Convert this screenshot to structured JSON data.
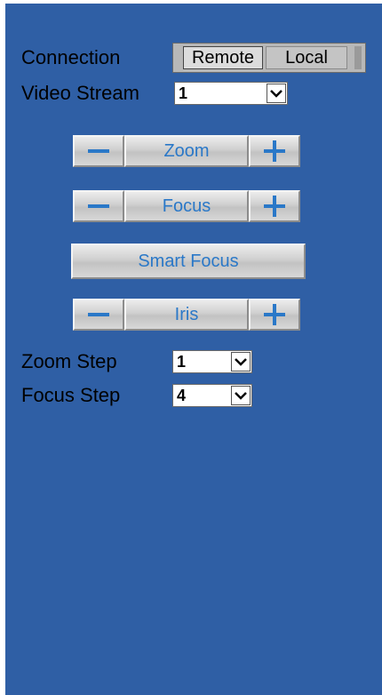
{
  "connection": {
    "label": "Connection",
    "options": [
      "Remote",
      "Local"
    ],
    "selected": "Remote"
  },
  "video_stream": {
    "label": "Video Stream",
    "value": "1"
  },
  "controls": {
    "zoom": {
      "label": "Zoom"
    },
    "focus": {
      "label": "Focus"
    },
    "smart_focus": {
      "label": "Smart Focus"
    },
    "iris": {
      "label": "Iris"
    }
  },
  "zoom_step": {
    "label": "Zoom Step",
    "value": "1"
  },
  "focus_step": {
    "label": "Focus Step",
    "value": "4"
  },
  "colors": {
    "panel_background": "#2f5fa5",
    "button_text": "#2a78c8"
  },
  "icons": {
    "minus": "minus-icon",
    "plus": "plus-icon",
    "dropdown": "chevron-down-icon"
  }
}
